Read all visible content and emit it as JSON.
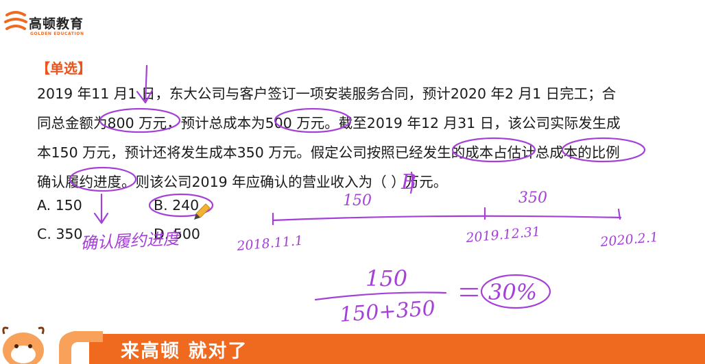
{
  "logo": {
    "name_cn": "高顿教育",
    "name_en": "GOLDEN EDUCATION",
    "colors": {
      "brand": "#ef6a1f",
      "text": "#222222"
    }
  },
  "question": {
    "type_tag": "【单选】",
    "lines": [
      "2019 年11 月1 日，东大公司与客户签订一项安装服务合同，预计2020 年2 月1 日完工；合",
      "同总金额为800 万元，预计总成本为500 万元。截至2019 年12 月31 日，该公司实际发生成",
      "本150 万元，预计还将发生成本350 万元。假定公司按照已经发生的成本占估计总成本的比例",
      "确认履约进度。则该公司2019 年应确认的营业收入为（   ）万元。"
    ],
    "options": {
      "a": "A. 150",
      "b": "B. 240",
      "c": "C. 350",
      "d": "D. 500"
    }
  },
  "annotations": {
    "answer_mark": "B",
    "under_progress": "确认履约进度",
    "timeline": {
      "segment_1": "150",
      "segment_2": "350",
      "start_date": "2018.11.1",
      "mid_date": "2019.12.31",
      "end_date": "2020.2.1"
    },
    "fraction": {
      "numerator": "150",
      "denominator": "150+350",
      "result": "30%"
    },
    "colors": {
      "ink": "#a43fd8",
      "pencil": "#f2b233"
    }
  },
  "banner": {
    "slogan": "来高顿 就对了",
    "colors": {
      "bar": "#ef6a1f",
      "mascot": "#f7a15a"
    }
  }
}
